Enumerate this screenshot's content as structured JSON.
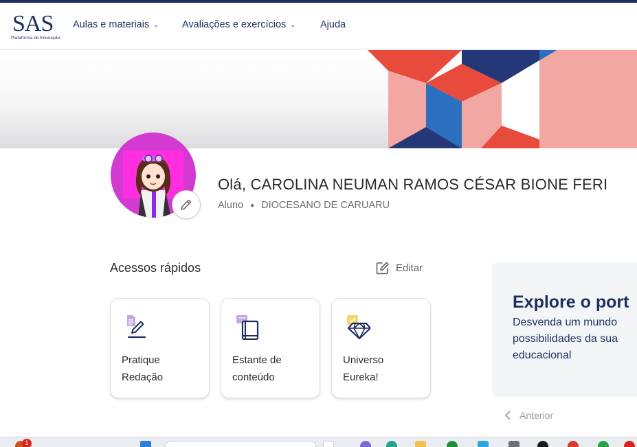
{
  "app": {
    "logo_text": "SAS",
    "logo_subtitle": "Plataforma de Educação"
  },
  "nav": {
    "items": [
      {
        "label": "Aulas e materiais",
        "has_dropdown": true
      },
      {
        "label": "Avaliações e exercícios",
        "has_dropdown": true
      },
      {
        "label": "Ajuda",
        "has_dropdown": false
      }
    ]
  },
  "profile": {
    "greeting": "Olá, CAROLINA NEUMAN RAMOS CÉSAR BIONE FERI",
    "role": "Aluno",
    "school": "DIOCESANO DE CARUARU"
  },
  "quick_access": {
    "title": "Acessos rápidos",
    "edit_label": "Editar",
    "items": [
      {
        "line1": "Pratique",
        "line2": "Redação",
        "icon": "pen-icon"
      },
      {
        "line1": "Estante de",
        "line2": "conteúdo",
        "icon": "book-icon"
      },
      {
        "line1": "Universo",
        "line2": "Eureka!",
        "icon": "diamond-icon"
      }
    ]
  },
  "explore": {
    "title": "Explore o port",
    "line1": "Desvenda um mundo",
    "line2": "possibilidades da sua",
    "line3": "educacional"
  },
  "carousel": {
    "prev_label": "Anterior"
  },
  "taskbar": {
    "badge_count": "1"
  },
  "colors": {
    "brand_navy": "#1c2f5e",
    "banner_red": "#e84a3c",
    "banner_pink": "#f3a7a2",
    "banner_blue": "#2d6fbf",
    "avatar_bg": "#d23ad2"
  }
}
